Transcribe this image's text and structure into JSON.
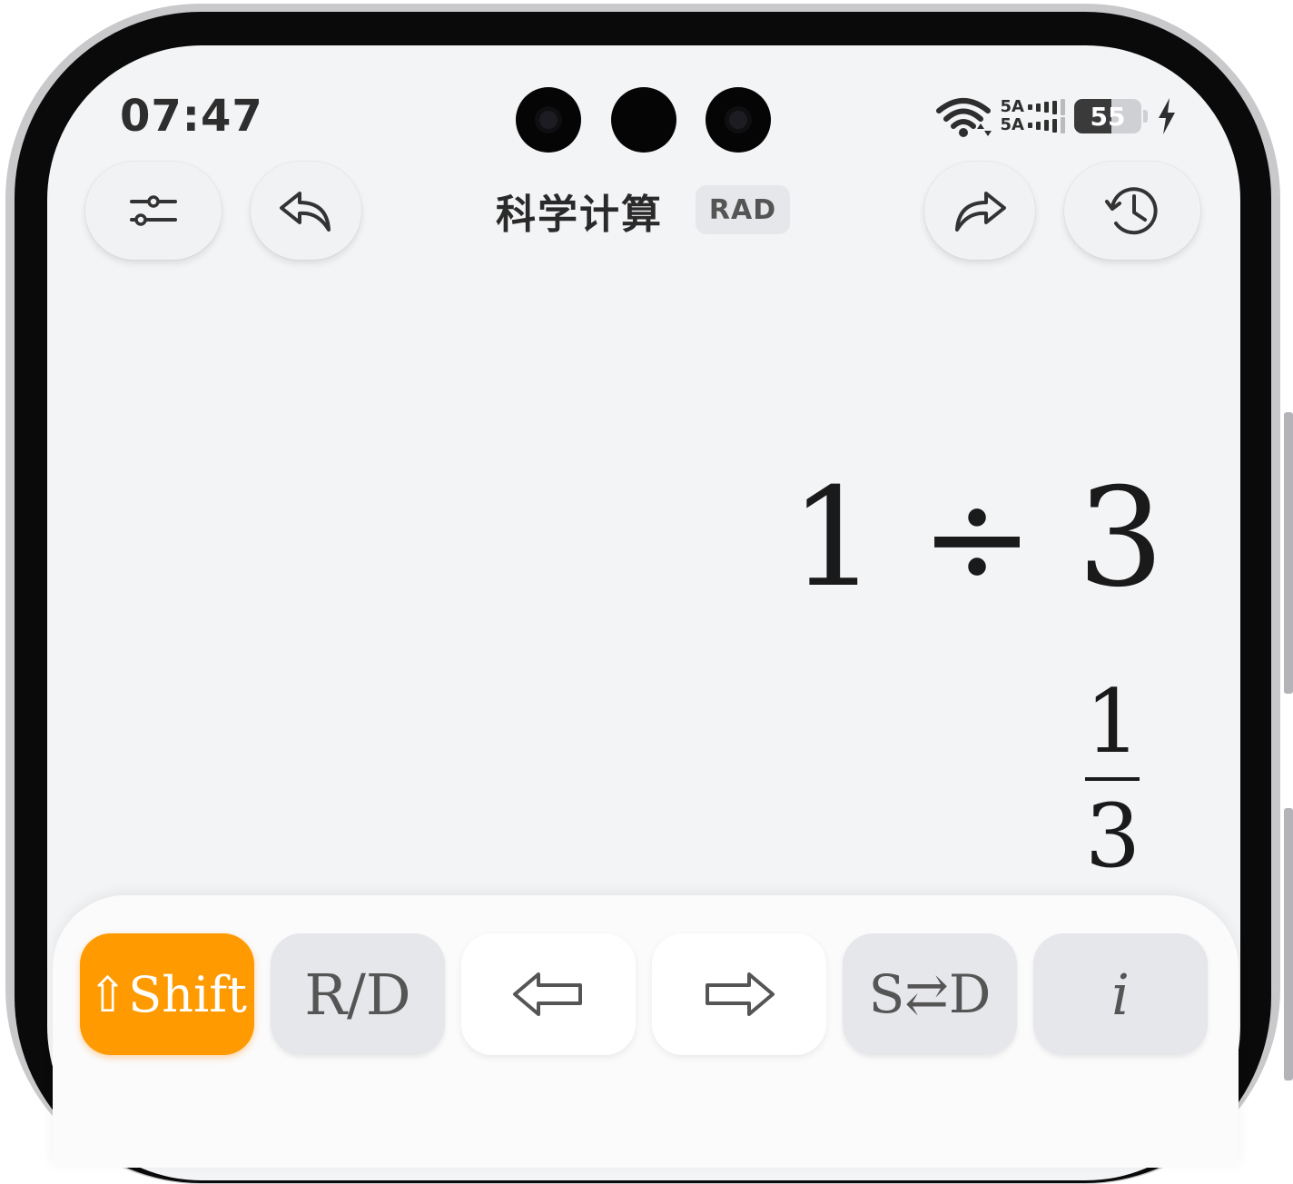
{
  "status_bar": {
    "time": "07:47",
    "network_line1": "5A",
    "network_line2": "5A",
    "battery_level": "55"
  },
  "header": {
    "title": "科学计算",
    "mode_badge": "RAD"
  },
  "display": {
    "expression": "1 ÷ 3",
    "result_numerator": "1",
    "result_denominator": "3"
  },
  "keys": {
    "shift": "⇧Shift",
    "rd": "R/D",
    "sd": "S⇄D",
    "imag": "i"
  },
  "colors": {
    "accent": "#ff9a00",
    "screen_bg": "#f3f4f6",
    "text": "#1a1a1a"
  }
}
